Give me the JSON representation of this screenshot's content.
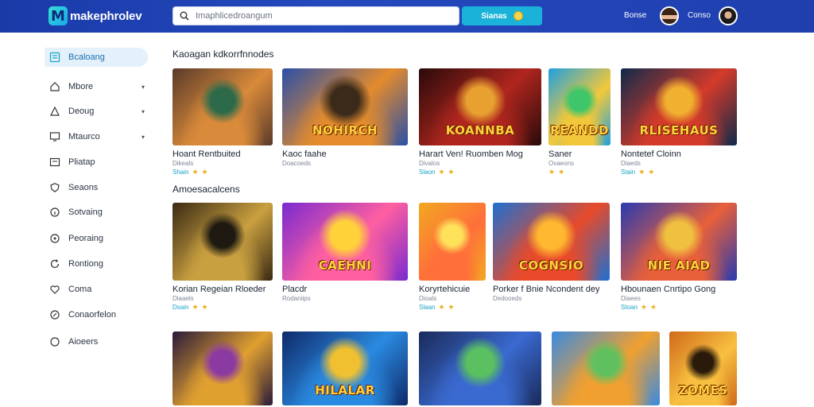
{
  "header": {
    "logo_mark": "M",
    "logo_text": "makephrolev",
    "search_placeholder": "Imaphlicedroangum",
    "search_button": "Sianas",
    "user1_label": "Bonse",
    "user2_label": "Conso"
  },
  "sidebar": {
    "items": [
      {
        "label": "Bcaloang",
        "icon": "grid-icon",
        "chevron": false
      },
      {
        "label": "Mbore",
        "icon": "home-icon",
        "chevron": true
      },
      {
        "label": "Deoug",
        "icon": "triangle-icon",
        "chevron": true
      },
      {
        "label": "Mtaurco",
        "icon": "monitor-icon",
        "chevron": true
      },
      {
        "label": "Pliatap",
        "icon": "tv-icon",
        "chevron": false
      },
      {
        "label": "Seaons",
        "icon": "shield-icon",
        "chevron": false
      },
      {
        "label": "Sotvaing",
        "icon": "info-icon",
        "chevron": false
      },
      {
        "label": "Peoraing",
        "icon": "chat-icon",
        "chevron": false
      },
      {
        "label": "Rontiong",
        "icon": "refresh-icon",
        "chevron": false
      },
      {
        "label": "Coma",
        "icon": "heart-icon",
        "chevron": false
      },
      {
        "label": "Conaorfelon",
        "icon": "link-icon",
        "chevron": false
      },
      {
        "label": "Aioeers",
        "icon": "circle-icon",
        "chevron": false
      }
    ]
  },
  "sections": [
    {
      "title": "Kaoagan kdkorrfnnodes",
      "cards": [
        {
          "name": "Hoant Rentbuited",
          "sub": "Dikeals",
          "rating_label": "Shain",
          "stars": 2,
          "art_title": "",
          "palette": [
            "#5a3a2a",
            "#d98a3a",
            "#2d6a4a"
          ]
        },
        {
          "name": "Kaoc faahe",
          "sub": "Doacoeds",
          "rating_label": "",
          "stars": 0,
          "art_title": "NOHIRCH",
          "palette": [
            "#2a4fa8",
            "#e38b2d",
            "#3b2a1a"
          ]
        },
        {
          "name": "Harart Ven! Ruomben Mog",
          "sub": "Divalos",
          "rating_label": "Slaon",
          "stars": 2,
          "art_title": "KOANNBA",
          "palette": [
            "#2a0a0a",
            "#b0261e",
            "#e8a030"
          ]
        },
        {
          "name": "Saner",
          "sub": "Ovaeons",
          "rating_label": "",
          "stars": 2,
          "art_title": "REANDD",
          "palette": [
            "#1fa0e0",
            "#f2c83a",
            "#3fc56a"
          ]
        },
        {
          "name": "Nontetef Cloinn",
          "sub": "Diaeds",
          "rating_label": "Stain",
          "stars": 2,
          "art_title": "RLISEHAUS",
          "palette": [
            "#0f2a4a",
            "#d43a2a",
            "#f0b030"
          ]
        }
      ]
    },
    {
      "title": "Amoesacalcens",
      "cards": [
        {
          "name": "Korian Regeian Rloeder",
          "sub": "Diaaels",
          "rating_label": "Dsain",
          "stars": 2,
          "art_title": "",
          "palette": [
            "#3a2a14",
            "#c9a040",
            "#1e1a12"
          ]
        },
        {
          "name": "Placdr",
          "sub": "Rodaniips",
          "rating_label": "",
          "stars": 0,
          "art_title": "CAEHNI",
          "palette": [
            "#7a2ad0",
            "#ff5fa0",
            "#ffd23a"
          ]
        },
        {
          "name": "Koryrtehicuie",
          "sub": "Dioals",
          "rating_label": "Slaan",
          "stars": 2,
          "art_title": "",
          "palette": [
            "#f2a820",
            "#ff6f3a",
            "#ffe15a"
          ]
        },
        {
          "name": "Porker f Bnie Ncondent dey",
          "sub": "Dedooeds",
          "rating_label": "",
          "stars": 0,
          "art_title": "COGNSIO",
          "palette": [
            "#1e6fd0",
            "#e84a2a",
            "#ffb830"
          ]
        },
        {
          "name": "Hbounaen Cnrtipo Gong",
          "sub": "Diaees",
          "rating_label": "Stoan",
          "stars": 2,
          "art_title": "NIE AIAD",
          "palette": [
            "#2a3ab0",
            "#e8603a",
            "#f0c040"
          ]
        }
      ]
    },
    {
      "title": "",
      "cards": [
        {
          "name": "",
          "sub": "",
          "rating_label": "",
          "stars": 0,
          "art_title": "",
          "palette": [
            "#2a1a3a",
            "#e0a030",
            "#8a3aa0"
          ]
        },
        {
          "name": "",
          "sub": "",
          "rating_label": "",
          "stars": 0,
          "art_title": "HILALAR",
          "palette": [
            "#0f2a6a",
            "#2a8ae0",
            "#f0c030"
          ]
        },
        {
          "name": "",
          "sub": "",
          "rating_label": "",
          "stars": 0,
          "art_title": "",
          "palette": [
            "#1a2a5a",
            "#3a6ad0",
            "#5ac060"
          ]
        },
        {
          "name": "",
          "sub": "",
          "rating_label": "",
          "stars": 0,
          "art_title": "",
          "palette": [
            "#3a8ae0",
            "#f0a030",
            "#60c060"
          ]
        },
        {
          "name": "",
          "sub": "",
          "rating_label": "",
          "stars": 0,
          "art_title": "ZOMES",
          "palette": [
            "#d06a1a",
            "#f8c040",
            "#2a1a0a"
          ]
        }
      ]
    }
  ]
}
